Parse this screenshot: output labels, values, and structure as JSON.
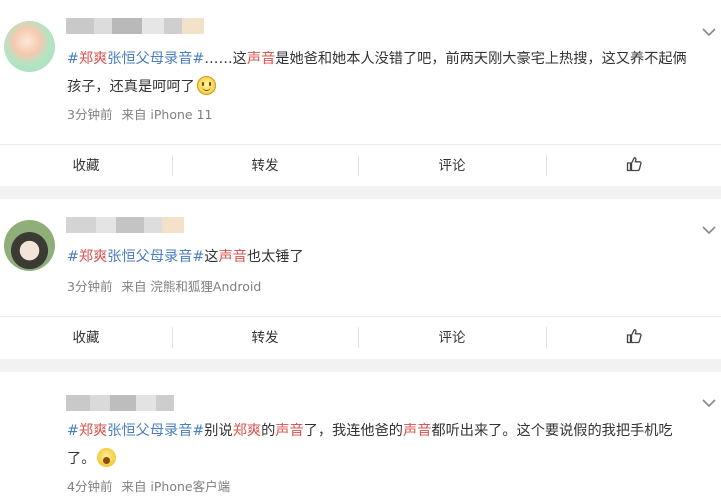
{
  "posts": [
    {
      "hashtag_prefix": "#",
      "hashtag_name_a": "郑爽",
      "hashtag_rest": "张恒父母录音#",
      "text_1": "……这",
      "text_highlight_1": "声音",
      "text_2": "是她爸和她本人没错了吧，前两天刚大豪宅上热搜，这又养不起俩孩子，还真是呵呵了",
      "emoji": "smile-emoji",
      "time": "3分钟前",
      "source": "来自 iPhone 11"
    },
    {
      "hashtag_prefix": "#",
      "hashtag_name_a": "郑爽",
      "hashtag_rest": "张恒父母录音#",
      "text_1": "这",
      "text_highlight_1": "声音",
      "text_2": "也太锤了",
      "time": "3分钟前",
      "source": "来自 浣熊和狐狸Android"
    },
    {
      "hashtag_prefix": "#",
      "hashtag_name_a": "郑爽",
      "hashtag_rest": "张恒父母录音#",
      "text_1": "别说",
      "text_highlight_1": "郑爽",
      "text_2": "的",
      "text_highlight_2": "声音",
      "text_3": "了，我连他爸的",
      "text_highlight_3": "声音",
      "text_4": "都听出来了。这个要说假的我把手机吃了。",
      "emoji": "wow-emoji",
      "time": "4分钟前",
      "source": "来自 iPhone客户端"
    }
  ],
  "actions": {
    "favorite": "收藏",
    "repost": "转发",
    "comment": "评论"
  },
  "icons": {
    "more": "chevron-down-icon",
    "like": "thumbs-up-icon"
  },
  "colors": {
    "hashtag": "#4a7ec0",
    "highlight": "#d9534f",
    "meta": "#808080"
  }
}
